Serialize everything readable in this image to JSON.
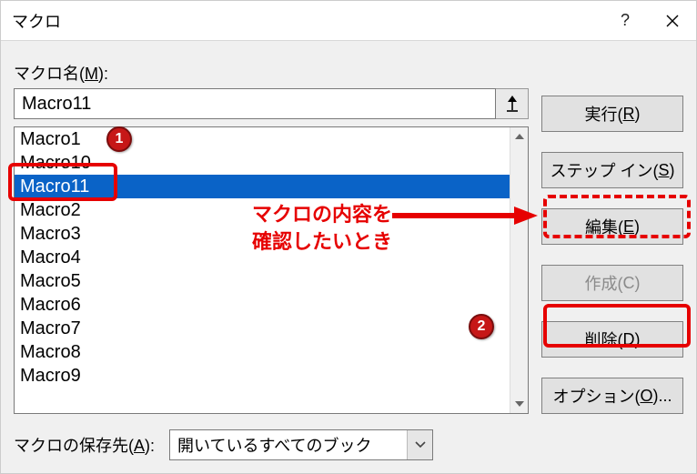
{
  "titlebar": {
    "title": "マクロ",
    "help": "?",
    "close": "×"
  },
  "labels": {
    "macro_name_prefix": "マクロ名(",
    "macro_name_key": "M",
    "macro_name_suffix": "):",
    "save_loc_prefix": "マクロの保存先(",
    "save_loc_key": "A",
    "save_loc_suffix": "):"
  },
  "name_input": {
    "value": "Macro11"
  },
  "list": {
    "items": [
      {
        "label": "Macro1",
        "selected": false
      },
      {
        "label": "Macro10",
        "selected": false
      },
      {
        "label": "Macro11",
        "selected": true
      },
      {
        "label": "Macro2",
        "selected": false
      },
      {
        "label": "Macro3",
        "selected": false
      },
      {
        "label": "Macro4",
        "selected": false
      },
      {
        "label": "Macro5",
        "selected": false
      },
      {
        "label": "Macro6",
        "selected": false
      },
      {
        "label": "Macro7",
        "selected": false
      },
      {
        "label": "Macro8",
        "selected": false
      },
      {
        "label": "Macro9",
        "selected": false
      }
    ]
  },
  "buttons": {
    "run": {
      "pre": "実行(",
      "key": "R",
      "post": ")",
      "disabled": false
    },
    "stepin": {
      "pre": "ステップ イン(",
      "key": "S",
      "post": ")",
      "disabled": false
    },
    "edit": {
      "pre": "編集(",
      "key": "E",
      "post": ")",
      "disabled": false
    },
    "create": {
      "pre": "作成(",
      "key": "C",
      "post": ")",
      "disabled": true
    },
    "delete": {
      "pre": "削除(",
      "key": "D",
      "post": ")",
      "disabled": false
    },
    "options": {
      "pre": "オプション(",
      "key": "O",
      "post": ")...",
      "disabled": false
    }
  },
  "save_loc": {
    "value": "開いているすべてのブック"
  },
  "annotations": {
    "badge1": "1",
    "badge2": "2",
    "text_line1": "マクロの内容を",
    "text_line2": "確認したいとき"
  }
}
